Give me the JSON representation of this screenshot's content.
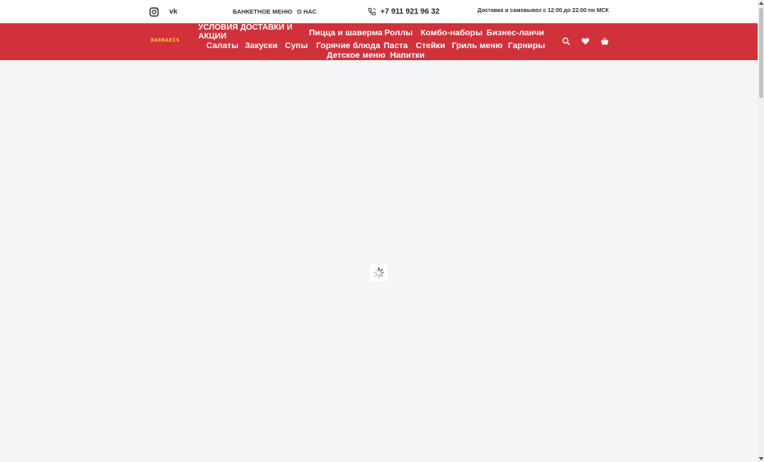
{
  "topbar": {
    "social": [
      {
        "name": "instagram-icon"
      },
      {
        "name": "vk-icon",
        "text": "vk"
      }
    ],
    "links": [
      "БАНКЕТНОЕ МЕНЮ",
      "О НАС"
    ],
    "phone": "+7 911 921 96 32",
    "hours": "Доставка и самовывоз с 12:00 до 22:00 по МСК"
  },
  "navbar": {
    "logo": "BARBARIS",
    "promo": "УСЛОВИЯ ДОСТАВКИ И АКЦИИ",
    "menu": [
      "Пицца и шаверма",
      "Роллы",
      "Комбо-наборы",
      "Бизнес-ланчи",
      "Салаты",
      "Закуски",
      "Супы",
      "Горячие блюда",
      "Паста",
      "Стейки",
      "Гриль меню",
      "Гарниры",
      "Детское меню",
      "Напитки"
    ],
    "icons": [
      "search-icon",
      "heart-icon",
      "basket-icon"
    ]
  },
  "colors": {
    "nav_bg": "#d1313a",
    "page_bg": "#f3f5f7",
    "logo": "#ffcc33"
  },
  "loader": {
    "icon": "spinner-icon"
  }
}
